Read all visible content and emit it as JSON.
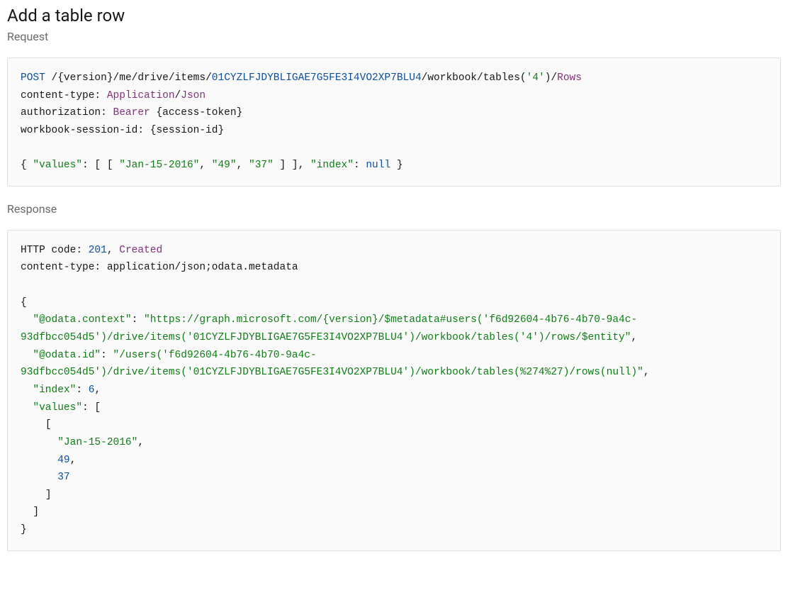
{
  "heading": "Add a table row",
  "request_label": "Request",
  "response_label": "Response",
  "request_code": {
    "line1": {
      "post": "POST",
      "p1": " /{",
      "version": "version",
      "p2": "}/",
      "me": "me",
      "p3": "/",
      "drive": "drive",
      "p4": "/",
      "items": "items",
      "p5": "/",
      "item_id": "01CYZLFJDYBLIGAE7G5FE3I4VO2XP7BLU4",
      "p6": "/",
      "workbook": "workbook",
      "p7": "/",
      "tables": "tables",
      "p8": "(",
      "tbl_q1": "'4'",
      "p9": ")/",
      "rows": "Rows"
    },
    "line2": {
      "header": "content-type",
      "colon": ": ",
      "app": "Application",
      "slash": "/",
      "json": "Json"
    },
    "line3": {
      "header": "authorization",
      "colon": ": ",
      "bearer": "Bearer",
      "space": " {",
      "token": "access-token",
      "close": "}"
    },
    "line4": {
      "header": "workbook-session-id",
      "colon": ": {",
      "sid": "session-id",
      "close": "}"
    },
    "body": {
      "open": "{ ",
      "k_values": "\"values\"",
      "c1": ": [ [ ",
      "v1": "\"Jan-15-2016\"",
      "c2": ", ",
      "v2": "\"49\"",
      "c3": ", ",
      "v3": "\"37\"",
      "c4": " ] ], ",
      "k_index": "\"index\"",
      "c5": ": ",
      "v_null": "null",
      "close": " }"
    }
  },
  "response_code": {
    "line1": {
      "http": "HTTP",
      "code_label": " code: ",
      "code": "201",
      "comma": ", ",
      "created": "Created"
    },
    "line2": {
      "ct_label": "content-type: ",
      "app": "application",
      "slash": "/",
      "json": "json",
      "semi": ";",
      "odata": "odata",
      "dot": ".",
      "meta": "metadata"
    },
    "body": {
      "open": "{",
      "ctx_k": "\"@odata.context\"",
      "ctx_v": "\"https://graph.microsoft.com/{version}/$metadata#users('f6d92604-4b76-4b70-9a4c-93dfbcc054d5')/drive/items('01CYZLFJDYBLIGAE7G5FE3I4VO2XP7BLU4')/workbook/tables('4')/rows/$entity\"",
      "id_k": "\"@odata.id\"",
      "id_v": "\"/users('f6d92604-4b76-4b70-9a4c-93dfbcc054d5')/drive/items('01CYZLFJDYBLIGAE7G5FE3I4VO2XP7BLU4')/workbook/tables(%274%27)/rows(null)\"",
      "idx_k": "\"index\"",
      "idx_v": "6",
      "val_k": "\"values\"",
      "arr_open": ": [",
      "inner_open": "[",
      "row_date": "\"Jan-15-2016\"",
      "row_n1": "49",
      "row_n2": "37",
      "inner_close": "]",
      "arr_close": "]",
      "close": "}"
    }
  }
}
